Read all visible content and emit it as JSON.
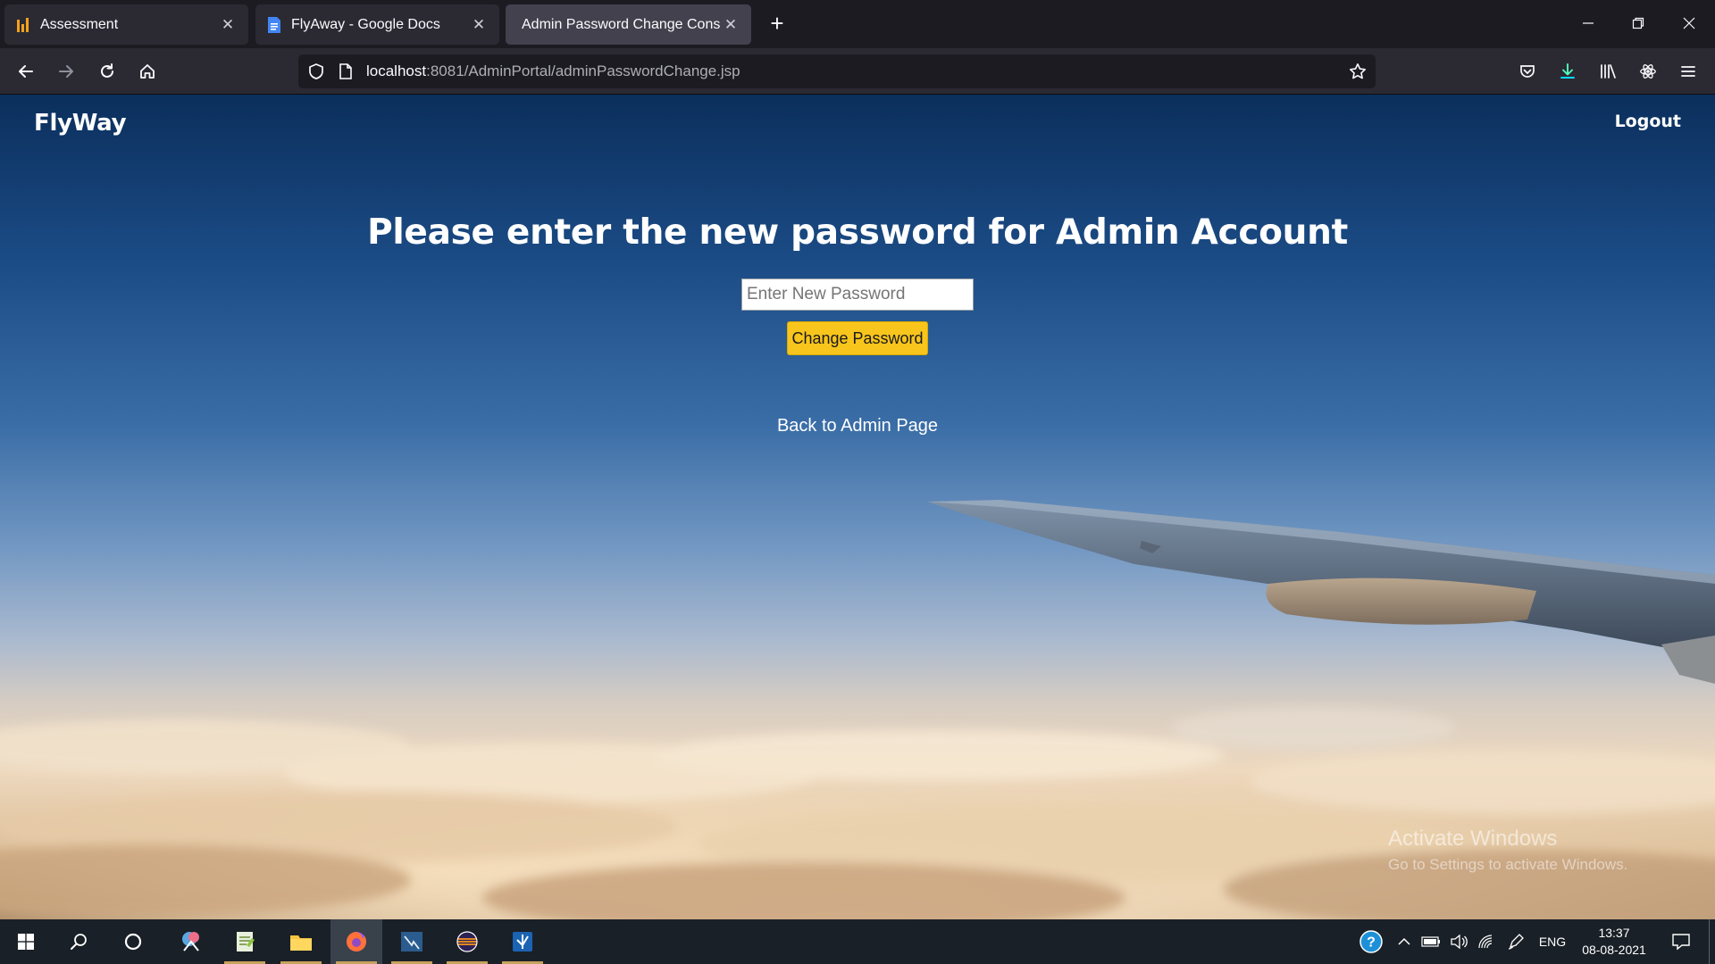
{
  "browser": {
    "tabs": [
      {
        "label": "Assessment",
        "icon": "assessment-favicon",
        "active": false
      },
      {
        "label": "FlyAway - Google Docs",
        "icon": "google-docs-favicon",
        "active": false
      },
      {
        "label": "Admin Password Change Console",
        "icon": "none",
        "active": true
      }
    ],
    "url": {
      "host": "localhost",
      "rest": ":8081/AdminPortal/adminPasswordChange.jsp"
    }
  },
  "page": {
    "brand": "FlyWay",
    "logout": "Logout",
    "heading": "Please enter the new password for Admin Account",
    "password_placeholder": "Enter New Password",
    "password_value": "",
    "change_button": "Change Password",
    "back_link": "Back to Admin Page",
    "accent_color": "#f8c51c"
  },
  "watermark": {
    "title": "Activate Windows",
    "subtitle": "Go to Settings to activate Windows."
  },
  "taskbar": {
    "language": "ENG",
    "time": "13:37",
    "date": "08-08-2021"
  }
}
